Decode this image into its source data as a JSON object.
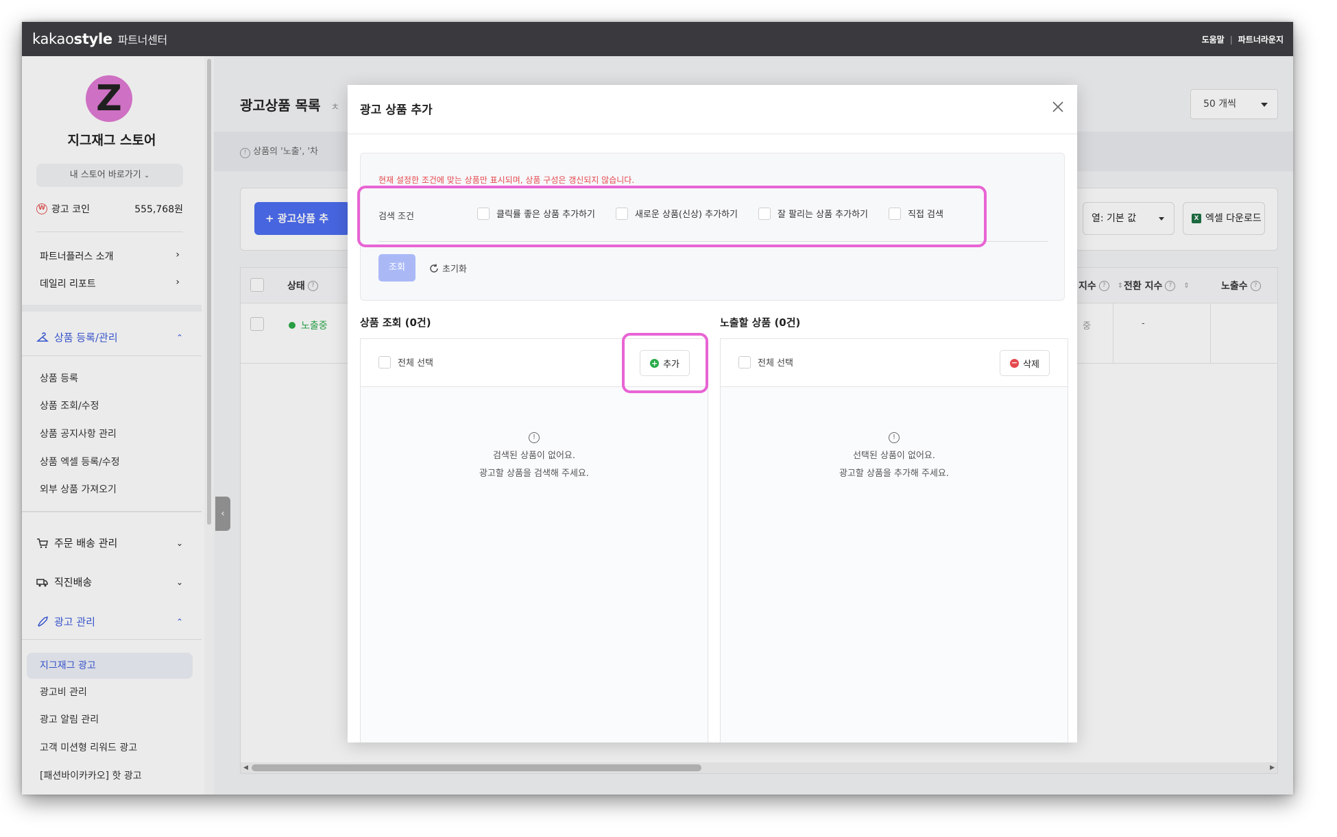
{
  "topbar": {
    "brand_kakao": "kakao",
    "brand_style": "style",
    "brand_sub": "파트너센터",
    "help": "도움말",
    "separator": "|",
    "lounge": "파트너라운지"
  },
  "sidebar": {
    "avatar_letter": "Z",
    "store_name": "지그재그 스토어",
    "store_link": "내 스토어 바로가기",
    "coin_label": "광고 코인",
    "coin_icon_text": "W",
    "coin_value": "555,768원",
    "links": [
      "파트너플러스 소개",
      "데일리 리포트"
    ],
    "section_products": "상품 등록/관리",
    "product_items": [
      "상품 등록",
      "상품 조회/수정",
      "상품 공지사항 관리",
      "상품 엑셀 등록/수정",
      "외부 상품 가져오기"
    ],
    "section_orders": "주문 배송 관리",
    "section_direct": "직진배송",
    "section_ads": "광고 관리",
    "ad_active": "지그재그 광고",
    "ad_items": [
      "광고비 관리",
      "광고 알림 관리",
      "고객 미션형 리워드 광고",
      "[패션바이카카오] 핫 광고"
    ]
  },
  "main": {
    "title": "광고상품 목록",
    "title_tail": "ㅊ",
    "per_page": "50 개씩",
    "notice": "상품의 '노출', '차",
    "add_button": "+ 광고상품 추",
    "column_button": "열: 기본 값",
    "excel_button": "엑셀 다운로드",
    "excel_icon_text": "X",
    "columns": {
      "status": "상태",
      "idx": "지수",
      "conv": "전환 지수",
      "impr": "노출수"
    },
    "row": {
      "status": "노출중",
      "partial": "중",
      "conv": "-"
    }
  },
  "modal": {
    "title": "광고 상품 추가",
    "warning": "현재 설정한 조건에 맞는 상품만 표시되며, 상품 구성은 갱신되지 않습니다.",
    "condition_label": "검색 조건",
    "options": [
      "클릭률 좋은 상품 추가하기",
      "새로운 상품(신상) 추가하기",
      "잘 팔리는 상품 추가하기",
      "직접 검색"
    ],
    "search_button": "조회",
    "reset_button": "초기화",
    "left_title": "상품 조회 (0건)",
    "right_title": "노출할 상품 (0건)",
    "select_all": "전체 선택",
    "add_button": "추가",
    "delete_button": "삭제",
    "left_empty_line1": "검색된 상품이 없어요.",
    "left_empty_line2": "광고할 상품을 검색해 주세요.",
    "right_empty_line1": "선택된 상품이 없어요.",
    "right_empty_line2": "광고할 상품을 추가해 주세요.",
    "info_icon_text": "!"
  },
  "colors": {
    "accent": "#4e6ef2",
    "highlight": "#e864d4",
    "topbar": "#3a3a3e",
    "warning": "#e5484d",
    "active_green": "#2bab4a"
  }
}
